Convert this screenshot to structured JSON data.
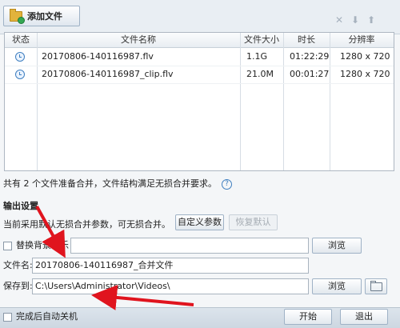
{
  "toolbar": {
    "add_file_label": "添加文件",
    "icons": [
      "close-icon",
      "move-down-icon",
      "move-up-icon"
    ]
  },
  "table": {
    "headers": {
      "status": "状态",
      "file_name": "文件名称",
      "file_size": "文件大小",
      "duration": "时长",
      "resolution": "分辨率"
    },
    "rows": [
      {
        "status_icon": "clock-icon",
        "file_name": "20170806-140116987.flv",
        "file_size": "1.1G",
        "duration": "01:22:29",
        "resolution": "1280 x 720"
      },
      {
        "status_icon": "clock-icon",
        "file_name": "20170806-140116987_clip.flv",
        "file_size": "21.0M",
        "duration": "00:01:27",
        "resolution": "1280 x 720"
      }
    ]
  },
  "summary": {
    "text": "共有 2 个文件准备合并，文件结构满足无损合并要求。"
  },
  "output": {
    "section_title": "输出设置",
    "param_text": "当前采用默认无损合并参数，可无损合并。",
    "custom_params_label": "自定义参数",
    "restore_default_label": "恢复默认",
    "replace_bgm_label": "替换背景音乐",
    "bgm_value": "",
    "browse_label": "浏览",
    "file_name_label": "文件名:",
    "file_name_value": "20170806-140116987_合并文件",
    "save_to_label": "保存到:",
    "save_path_value": "C:\\Users\\Administrator\\Videos\\",
    "browse_label_2": "浏览"
  },
  "footer": {
    "auto_shutdown_label": "完成后自动关机",
    "start_label": "开始",
    "cancel_label": "退出"
  },
  "colors": {
    "annotation_arrow": "#e0141e",
    "accent_blue": "#3f7fc0"
  }
}
